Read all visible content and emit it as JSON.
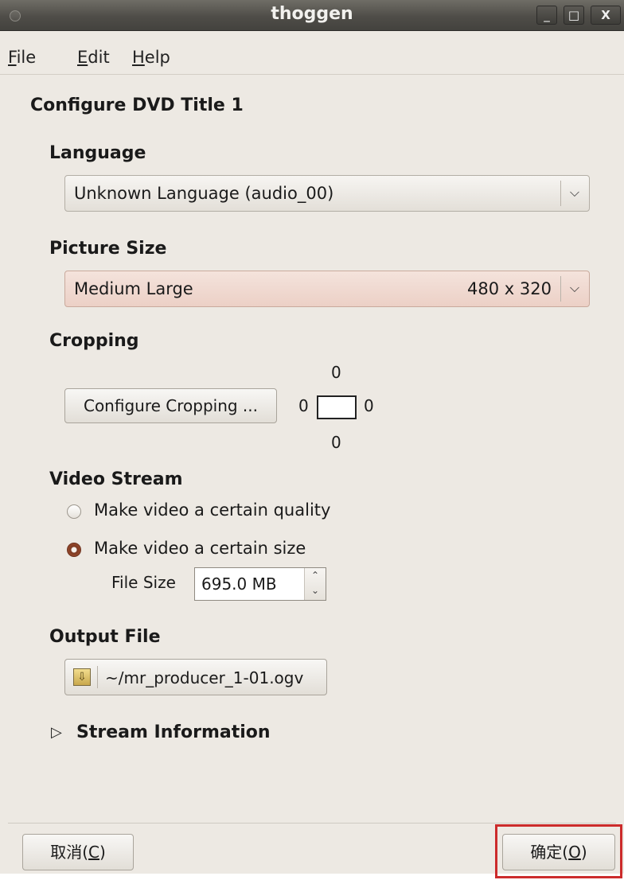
{
  "window": {
    "title": "thoggen",
    "controls": {
      "minimize": "_",
      "maximize": "□",
      "close": "X"
    }
  },
  "menu": [
    {
      "pre": "",
      "mnemonic": "F",
      "rest": "ile"
    },
    {
      "pre": "",
      "mnemonic": "E",
      "rest": "dit"
    },
    {
      "pre": "",
      "mnemonic": "H",
      "rest": "elp"
    }
  ],
  "page_title": "Configure DVD Title 1",
  "language": {
    "heading": "Language",
    "selected": "Unknown Language (audio_00)"
  },
  "picture_size": {
    "heading": "Picture Size",
    "selected": "Medium Large",
    "dimensions": "480 x 320"
  },
  "cropping": {
    "heading": "Cropping",
    "button_label": "Configure Cropping ...",
    "top": "0",
    "left": "0",
    "right": "0",
    "bottom": "0"
  },
  "video_stream": {
    "heading": "Video Stream",
    "option_quality": "Make video a certain quality",
    "option_size": "Make video a certain size",
    "selected": "size",
    "file_size_label": "File Size",
    "file_size_value": "695.0 MB"
  },
  "output_file": {
    "heading": "Output File",
    "path": "~/mr_producer_1-01.ogv"
  },
  "stream_information": {
    "label": "Stream Information",
    "expanded": false
  },
  "footer": {
    "cancel": {
      "pre": "取消(",
      "mnemonic": "C",
      "post": ")"
    },
    "ok": {
      "pre": "确定(",
      "mnemonic": "O",
      "post": ")"
    }
  },
  "colors": {
    "window_bg": "#ede9e3",
    "titlebar": "#4f4d48",
    "selected_combo": "#ecd0c6",
    "highlight_frame": "#cc2b2b"
  }
}
